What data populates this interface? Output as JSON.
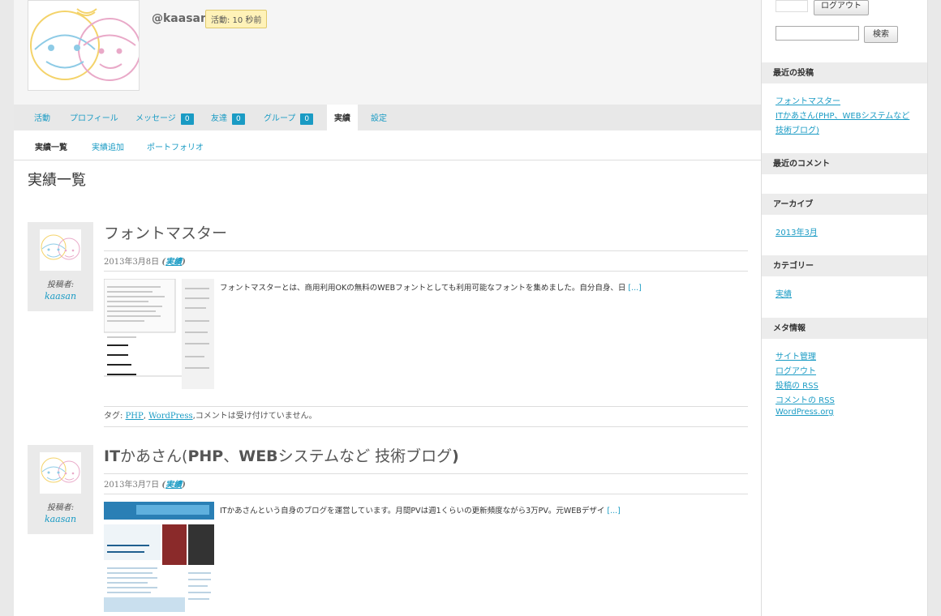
{
  "profile": {
    "handle": "@kaasan",
    "activity": "活動: 10 秒前"
  },
  "nav": {
    "items": [
      {
        "label": "活動"
      },
      {
        "label": "プロフィール"
      },
      {
        "label": "メッセージ",
        "count": "0"
      },
      {
        "label": "友達",
        "count": "0"
      },
      {
        "label": "グループ",
        "count": "0"
      },
      {
        "label": "実績"
      },
      {
        "label": "設定"
      }
    ],
    "active": "実績"
  },
  "subnav": {
    "items": [
      {
        "label": "実績一覧"
      },
      {
        "label": "実績追加"
      },
      {
        "label": "ポートフォリオ"
      }
    ]
  },
  "page_title": "実績一覧",
  "posts": [
    {
      "author_label": "投稿者:",
      "author_name": "kaasan",
      "title": "フォントマスター",
      "date": "2013年3月8日",
      "category": "実績",
      "excerpt": "フォントマスターとは、商用利用OKの無料のWEBフォントとしても利用可能なフォントを集めました。自分自身、日",
      "more": "[...]",
      "tags_label": "タグ:",
      "tags": [
        "PHP",
        "WordPress"
      ],
      "comments": ",コメントは受け付けていません。"
    },
    {
      "author_label": "投稿者:",
      "author_name": "kaasan",
      "title_bold1": "IT",
      "title_mid1": "かあさん(",
      "title_bold2": "PHP",
      "title_mid2": "、",
      "title_bold3": "WEB",
      "title_mid3": "システムなど 技術ブログ",
      "title_end": ")",
      "date": "2013年3月7日",
      "category": "実績",
      "excerpt": "ITかあさんという自身のブログを運営しています。月間PVは週1くらいの更新頻度ながら3万PV。元WEBデザイ",
      "more": "[...]"
    }
  ],
  "sidebar": {
    "logout_button": "ログアウト",
    "search_button": "検索",
    "search_value": "",
    "recent_posts_title": "最近の投稿",
    "recent_posts": [
      "フォントマスター",
      "ITかあさん(PHP、WEBシステムなど",
      "技術ブログ)"
    ],
    "recent_comments_title": "最近のコメント",
    "archives_title": "アーカイブ",
    "archives": [
      "2013年3月"
    ],
    "categories_title": "カテゴリー",
    "categories": [
      "実績"
    ],
    "meta_title": "メタ情報",
    "meta": [
      "サイト管理",
      "ログアウト",
      "投稿の RSS",
      "コメントの RSS",
      "WordPress.org"
    ]
  },
  "colors": {
    "link": "#1a9bc4",
    "badge_bg": "#fff2b8",
    "count_bg": "#1a9bc4",
    "sidebar_head_bg": "#ececec"
  }
}
